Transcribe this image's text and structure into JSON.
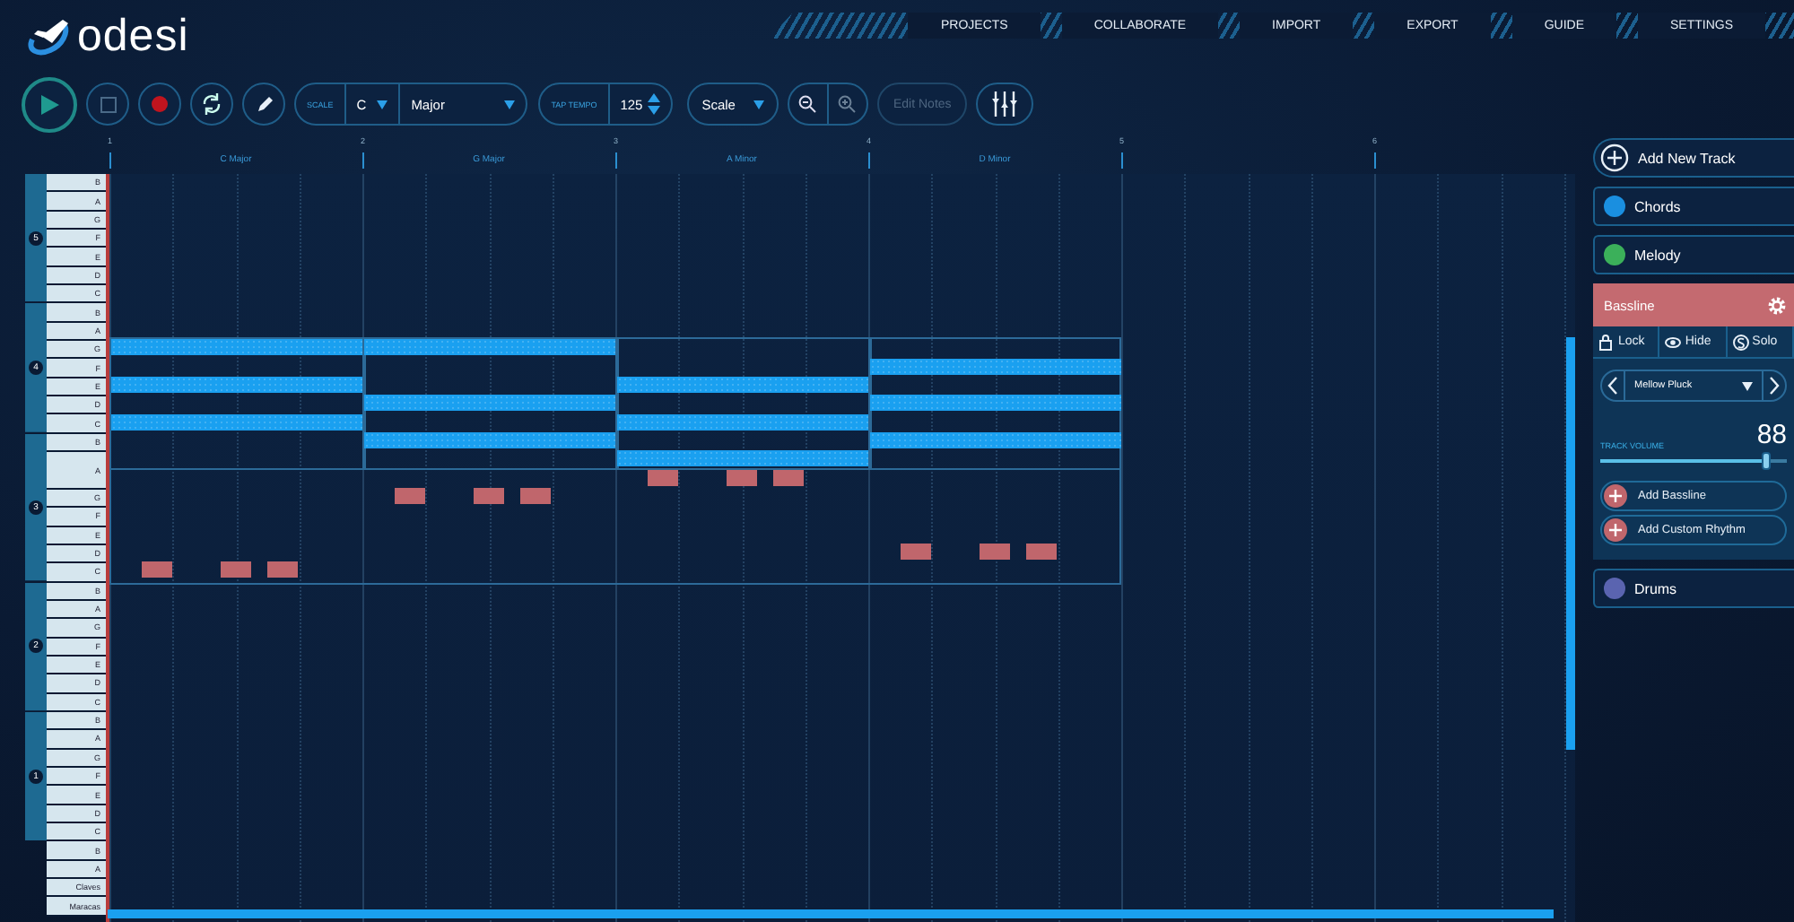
{
  "logo": {
    "text": "odesi"
  },
  "nav": [
    "PROJECTS",
    "COLLABORATE",
    "IMPORT",
    "EXPORT",
    "GUIDE",
    "SETTINGS"
  ],
  "toolbar": {
    "scale_label": "SCALE",
    "key": "C",
    "mode": "Major",
    "tempo_label": "TAP TEMPO",
    "tempo": "125",
    "view": "Scale",
    "edit_notes": {
      "label": "Edit Notes",
      "disabled": true
    }
  },
  "ruler": {
    "bars": [
      "1",
      "2",
      "3",
      "4",
      "5",
      "6"
    ],
    "chords": [
      "C Major",
      "G Major",
      "A Minor",
      "D Minor"
    ]
  },
  "octaves": [
    "5",
    "4",
    "3",
    "2",
    "1"
  ],
  "keys": [
    {
      "label": "B",
      "kind": "key"
    },
    {
      "label": "A",
      "kind": "key"
    },
    {
      "label": "G",
      "kind": "key"
    },
    {
      "label": "F",
      "kind": "key"
    },
    {
      "label": "E",
      "kind": "key"
    },
    {
      "label": "D",
      "kind": "key"
    },
    {
      "label": "C",
      "kind": "key"
    },
    {
      "label": "B",
      "kind": "key"
    },
    {
      "label": "A",
      "kind": "key"
    },
    {
      "label": "G",
      "kind": "key"
    },
    {
      "label": "F",
      "kind": "key"
    },
    {
      "label": "E",
      "kind": "key"
    },
    {
      "label": "D",
      "kind": "key"
    },
    {
      "label": "C",
      "kind": "key"
    },
    {
      "label": "B",
      "kind": "key"
    },
    {
      "label": "A",
      "kind": "wide"
    },
    {
      "label": "G",
      "kind": "key"
    },
    {
      "label": "F",
      "kind": "key"
    },
    {
      "label": "E",
      "kind": "key"
    },
    {
      "label": "D",
      "kind": "key"
    },
    {
      "label": "C",
      "kind": "key"
    },
    {
      "label": "B",
      "kind": "key"
    },
    {
      "label": "A",
      "kind": "key"
    },
    {
      "label": "G",
      "kind": "key"
    },
    {
      "label": "F",
      "kind": "key"
    },
    {
      "label": "E",
      "kind": "key"
    },
    {
      "label": "D",
      "kind": "key"
    },
    {
      "label": "C",
      "kind": "key"
    },
    {
      "label": "B",
      "kind": "key"
    },
    {
      "label": "A",
      "kind": "key"
    },
    {
      "label": "G",
      "kind": "key"
    },
    {
      "label": "F",
      "kind": "key"
    },
    {
      "label": "E",
      "kind": "key"
    },
    {
      "label": "D",
      "kind": "key"
    },
    {
      "label": "C",
      "kind": "key"
    },
    {
      "label": "B",
      "kind": "key"
    },
    {
      "label": "A",
      "kind": "key"
    },
    {
      "label": "Claves",
      "kind": "key"
    },
    {
      "label": "Maracas",
      "kind": "key"
    }
  ],
  "add_track": "Add New Track",
  "tracks": [
    {
      "name": "Chords",
      "color": "#1a8fe0",
      "expanded": false
    },
    {
      "name": "Melody",
      "color": "#3bb05a",
      "expanded": false
    },
    {
      "name": "Bassline",
      "color": "#c46a70",
      "expanded": true,
      "toggles": [
        {
          "label": "Lock",
          "on": false
        },
        {
          "label": "Hide",
          "on": false
        },
        {
          "label": "Solo",
          "on": false
        }
      ],
      "instrument": "Mellow Pluck",
      "volume_label": "TRACK VOLUME",
      "volume": "88",
      "level": 0.88,
      "actions": [
        "Add Bassline",
        "Add Custom Rhythm"
      ]
    },
    {
      "name": "Drums",
      "color": "#5a64b0",
      "expanded": false
    }
  ]
}
